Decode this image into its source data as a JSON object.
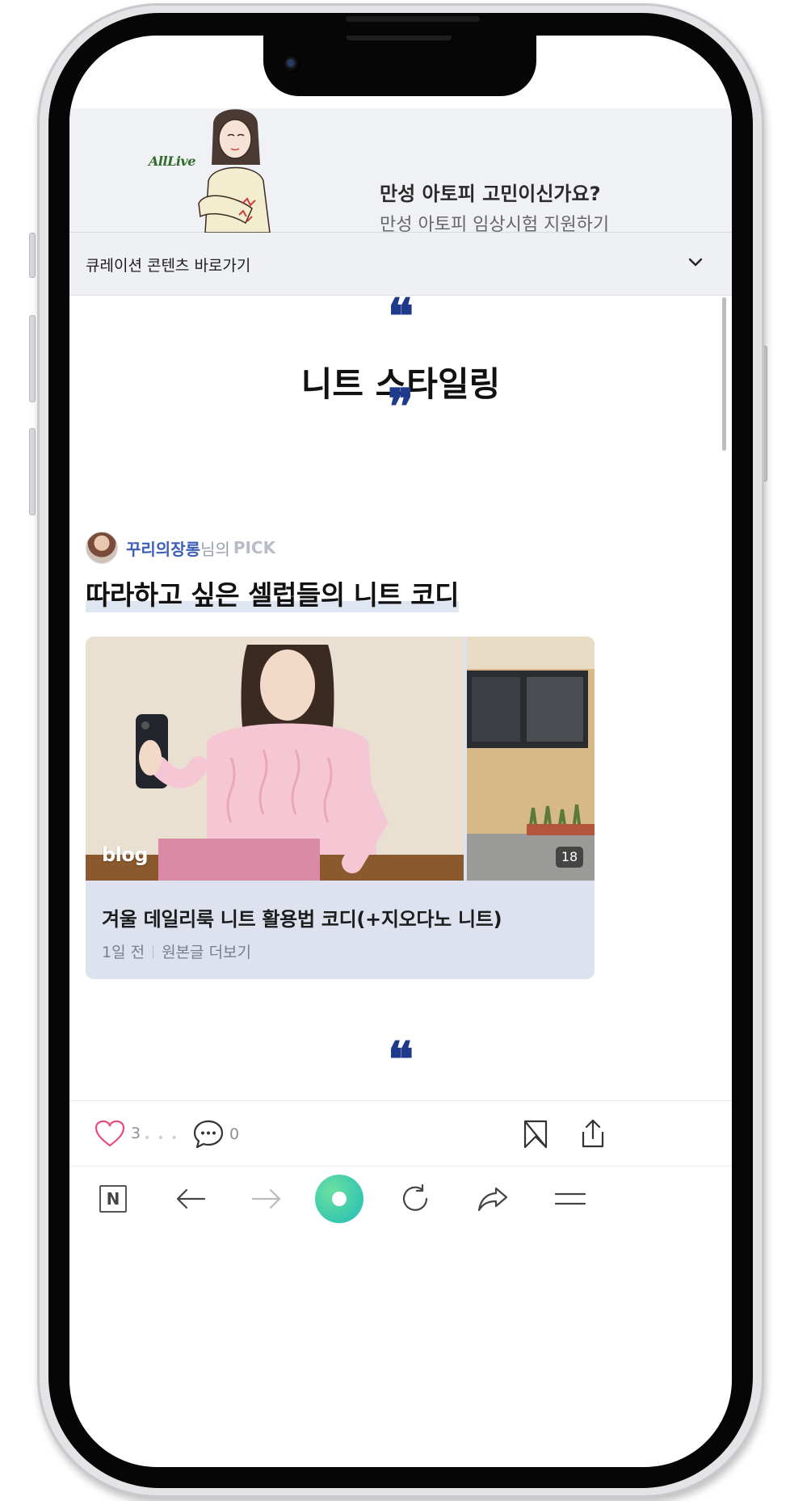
{
  "ad": {
    "brand": "AllLive",
    "title": "만성 아토피 고민이신가요?",
    "subtitle": "만성 아토피 임상시험 지원하기"
  },
  "curation": {
    "label": "큐레이션 콘텐츠 바로가기"
  },
  "section": {
    "open_quote": "❝",
    "title": "니트 스타일링",
    "close_quote": "❞"
  },
  "pick": {
    "author": "꾸리의장롱",
    "suffix": "님의",
    "pick_word": "PICK",
    "headline": "따라하고 싶은 셀럽들의 니트 코디"
  },
  "card": {
    "blog_label": "blog",
    "photo_count": "18",
    "title": "겨울 데일리룩 니트 활용법 코디(+지오다노 니트)",
    "time_ago": "1일 전",
    "more_link": "원본글 더보기"
  },
  "next_section": {
    "open_quote": "❝"
  },
  "actions": {
    "like_count": "3",
    "comment_count": "0"
  },
  "colors": {
    "accent_blue": "#1f3a8a",
    "author_blue": "#3c5db8",
    "like_pink": "#e84c7a",
    "card_bg": "#dde2ee"
  }
}
